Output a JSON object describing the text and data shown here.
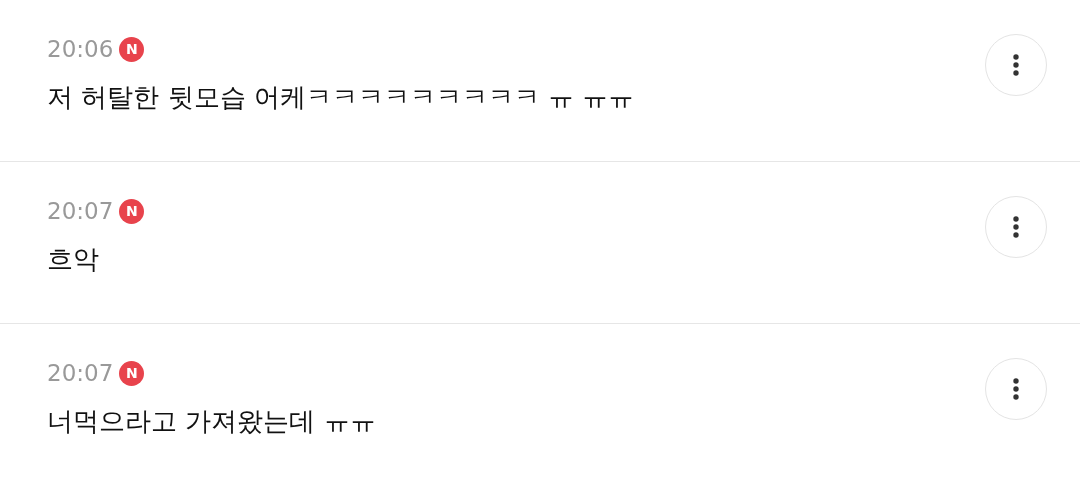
{
  "comments": [
    {
      "time": "20:06",
      "new": true,
      "badge": "N",
      "text": "저 허탈한 뒷모습 어케ㅋㅋㅋㅋㅋㅋㅋㅋㅋ ㅠ ㅠㅠ"
    },
    {
      "time": "20:07",
      "new": true,
      "badge": "N",
      "text": "흐악"
    },
    {
      "time": "20:07",
      "new": true,
      "badge": "N",
      "text": "너먹으라고 가져왔는데 ㅠㅠ"
    }
  ]
}
